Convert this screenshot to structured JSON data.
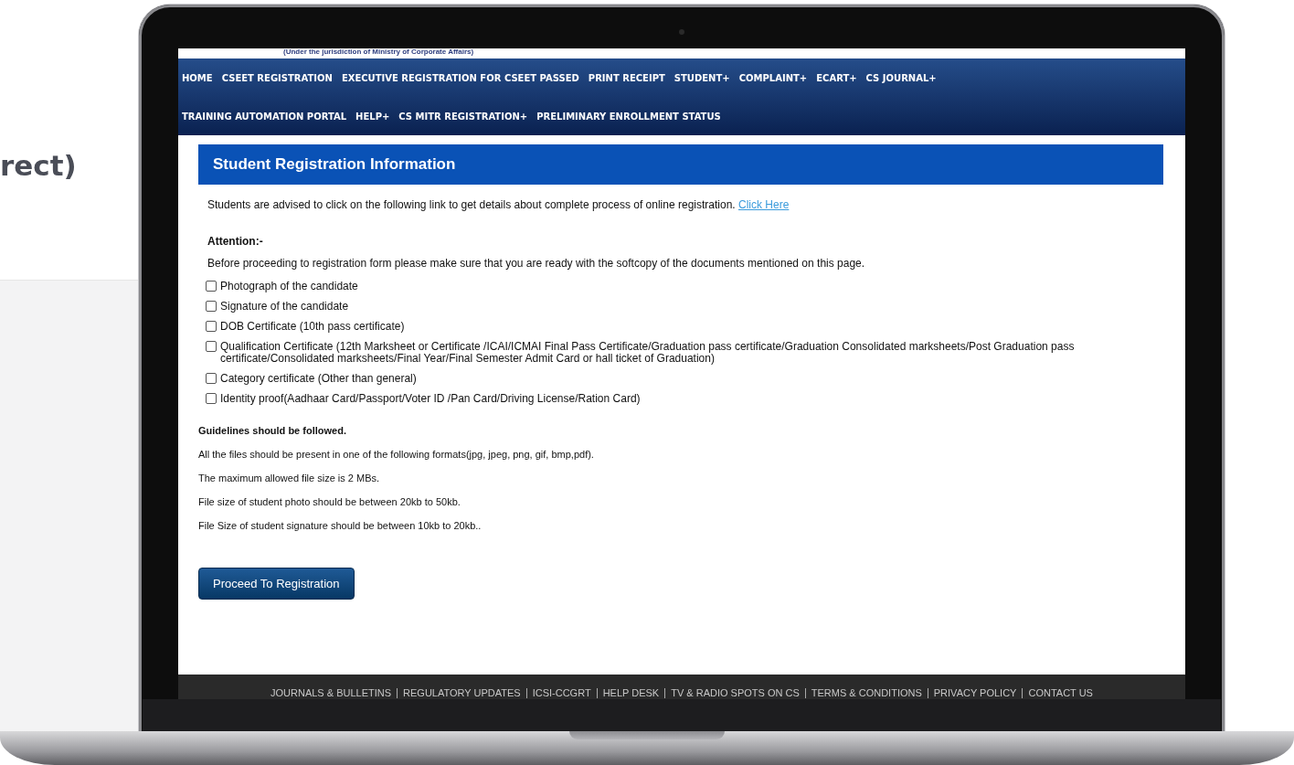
{
  "background": {
    "heading_fragment": "rect)"
  },
  "site": {
    "jurisdiction": "(Under the jurisdiction of Ministry of Corporate Affairs)",
    "nav_rows": [
      [
        "HOME",
        "CSEET REGISTRATION",
        "EXECUTIVE REGISTRATION FOR CSEET PASSED",
        "PRINT RECEIPT",
        "STUDENT+",
        "COMPLAINT+",
        "ECART+",
        "CS JOURNAL+"
      ],
      [
        "TRAINING AUTOMATION PORTAL",
        "HELP+",
        "CS MITR REGISTRATION+",
        "PRELIMINARY ENROLLMENT STATUS"
      ]
    ],
    "section_title": "Student Registration Information",
    "intro": {
      "text": "Students are advised to click on the following link to get details about complete process of online registration.",
      "link": "Click Here"
    },
    "attention_title": "Attention:-",
    "attention_text": "Before proceeding to registration form please make sure that you are ready with the softcopy of the documents mentioned on this page.",
    "documents": [
      {
        "label": "Photograph of the candidate",
        "checked": false
      },
      {
        "label": "Signature of the candidate",
        "checked": false
      },
      {
        "label": "DOB Certificate (10th pass certificate)",
        "checked": false
      },
      {
        "label": "Qualification Certificate (12th Marksheet or Certificate /ICAI/ICMAI Final Pass Certificate/Graduation pass certificate/Graduation Consolidated marksheets/Post Graduation pass certificate/Consolidated marksheets/Final Year/Final Semester Admit Card or hall ticket of Graduation)",
        "checked": false
      },
      {
        "label": "Category certificate (Other than general)",
        "checked": false
      },
      {
        "label": "Identity proof(Aadhaar Card/Passport/Voter ID /Pan Card/Driving License/Ration Card)",
        "checked": false
      }
    ],
    "guidelines_title": "Guidelines should be followed.",
    "guidelines": [
      "All the files should be present in one of the following formats(jpg, jpeg, png, gif, bmp,pdf).",
      "The maximum allowed file size is 2 MBs.",
      "File size of student photo should be between 20kb to 50kb.",
      "File Size of student signature should be between 10kb to 20kb.."
    ],
    "proceed_button": "Proceed To Registration",
    "footer_links": [
      "JOURNALS & BULLETINS",
      "REGULATORY UPDATES",
      "ICSI-CCGRT",
      "HELP DESK",
      "TV & RADIO SPOTS ON CS",
      "TERMS & CONDITIONS",
      "PRIVACY POLICY",
      "CONTACT US"
    ]
  }
}
